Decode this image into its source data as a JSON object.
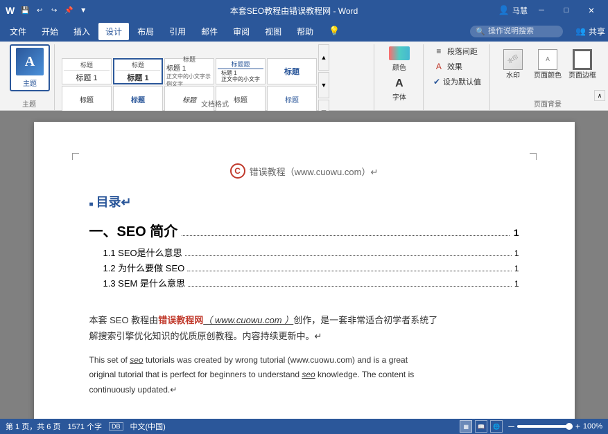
{
  "titlebar": {
    "quick_save": "💾",
    "undo": "↩",
    "redo": "↪",
    "pin": "📌",
    "dropdown": "▼",
    "title": "本套SEO教程由错误教程网 - Word",
    "user": "马慧",
    "minimize": "─",
    "restore": "□",
    "close": "✕"
  },
  "menubar": {
    "items": [
      "文件",
      "开始",
      "插入",
      "设计",
      "布局",
      "引用",
      "邮件",
      "审阅",
      "视图",
      "帮助"
    ],
    "active": "设计",
    "search_placeholder": "操作说明搜索",
    "share": "共享"
  },
  "ribbon": {
    "theme_label": "主题",
    "theme_btn": "主题",
    "styles_label": "文档格式",
    "style_items": [
      {
        "label": "标题",
        "type": "normal",
        "sublabel": "标题 1"
      },
      {
        "label": "标题",
        "type": "heading",
        "sublabel": "标题 1"
      },
      {
        "label": "标题",
        "type": "heading2"
      },
      {
        "label": "标题题目",
        "type": "title"
      },
      {
        "label": "标题",
        "type": "heading3"
      },
      {
        "label": "标题",
        "type": "normal2"
      }
    ],
    "color_label": "颜色",
    "font_label": "字体",
    "para_spacing_label": "段落间距",
    "effects_label": "效果",
    "default_label": "✔ 设为默认值",
    "watermark_label": "水印",
    "page_color_label": "页面颜色",
    "page_border_label": "页面边框",
    "page_bg_group_label": "页面背景"
  },
  "statusbar": {
    "page": "第 1 页，共 6 页",
    "words": "1571 个字",
    "lang": "中文(中国)",
    "zoom": "100%",
    "db_icon": "DB"
  },
  "document": {
    "watermark_text": "错误教程（www.cuowu.com）↵",
    "toc_title": "目录↵",
    "chapter1_title": "一、SEO 简介",
    "chapter1_num": "1",
    "toc_items": [
      {
        "label": "1.1 SEO是什么意思",
        "num": "1"
      },
      {
        "label": "1.2  为什么要做 SEO",
        "num": "1"
      },
      {
        "label": "1.3 SEM 是什么意思",
        "num": "1"
      }
    ],
    "para_zh": "本套 SEO 教程由",
    "para_zh_bold": "错误教程网",
    "para_zh_italic": "（ www.cuowu.com ）",
    "para_zh_rest": "创作，是一套非常适合初学者系统了解搜索引擎优化知识的优质原创教程。内容持续更新中。↵",
    "para_en": "This set of seo tutorials was created by wrong tutorial (www.cuowu.com) and is a great original tutorial that is perfect for beginners to understand seo knowledge. The content is continuously updated.↵"
  }
}
